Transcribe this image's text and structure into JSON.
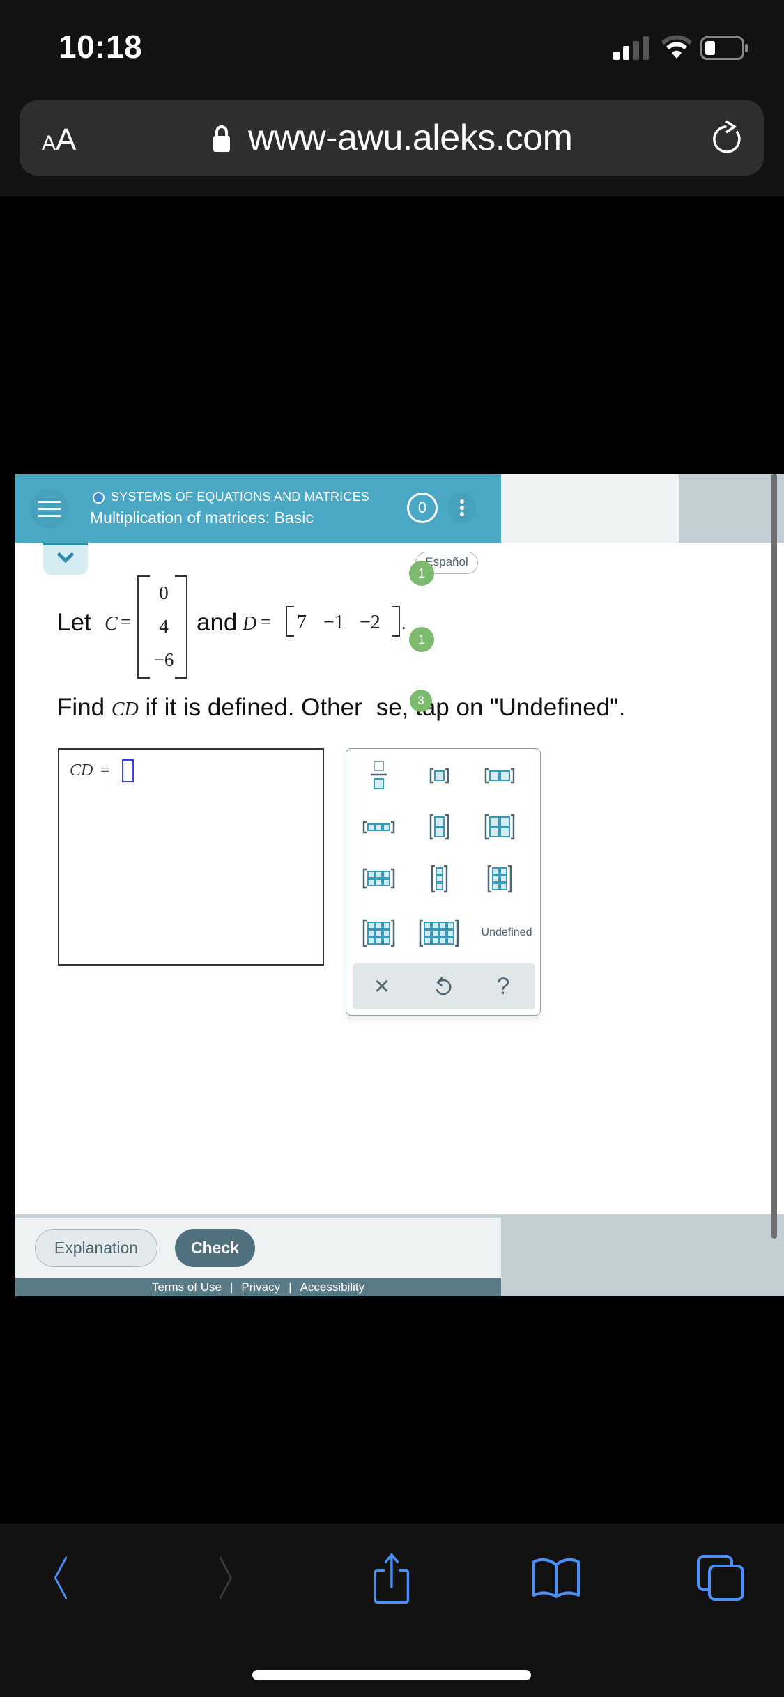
{
  "status_bar": {
    "time": "10:18",
    "icons": [
      "cellular-signal-icon",
      "wifi-icon",
      "battery-icon"
    ]
  },
  "browser": {
    "text_size_label_small": "A",
    "text_size_label_large": "A",
    "url": "www-awu.aleks.com",
    "secure": true
  },
  "header": {
    "topic": "SYSTEMS OF EQUATIONS AND MATRICES",
    "lesson": "Multiplication of matrices: Basic",
    "score": "0"
  },
  "language_button": "Español",
  "badges": [
    "1",
    "1",
    "3"
  ],
  "problem": {
    "let": "Let",
    "c_var": "C",
    "eq": "=",
    "c_values": [
      "0",
      "4",
      "−6"
    ],
    "and": "and",
    "d_var": "D",
    "d_values": [
      "7",
      "−1",
      "−2"
    ],
    "period": ".",
    "instruction": "Find CD if it is defined. Otherwise, tap on \"Undefined\".",
    "instruction_parts": {
      "pre": "Find ",
      "var": "CD",
      "post": " if it is defined. Other",
      "post2": "se, tap on \"Undefined\"."
    }
  },
  "answer": {
    "label": "CD",
    "eq": "=",
    "value": ""
  },
  "keypad": {
    "keys": [
      {
        "name": "fraction",
        "rows": 0,
        "cols": 0
      },
      {
        "name": "matrix-1x1",
        "rows": 1,
        "cols": 1
      },
      {
        "name": "matrix-1x2",
        "rows": 1,
        "cols": 2
      },
      {
        "name": "matrix-1x3",
        "rows": 1,
        "cols": 3
      },
      {
        "name": "matrix-2x1",
        "rows": 2,
        "cols": 1
      },
      {
        "name": "matrix-2x2",
        "rows": 2,
        "cols": 2
      },
      {
        "name": "matrix-2x3",
        "rows": 2,
        "cols": 3
      },
      {
        "name": "matrix-3x1",
        "rows": 3,
        "cols": 1
      },
      {
        "name": "matrix-3x2",
        "rows": 3,
        "cols": 2
      },
      {
        "name": "matrix-3x3",
        "rows": 3,
        "cols": 3
      },
      {
        "name": "matrix-3x4",
        "rows": 3,
        "cols": 4
      }
    ],
    "undefined_label": "Undefined",
    "clear": "×",
    "undo": "↺",
    "help": "?"
  },
  "footer": {
    "explanation": "Explanation",
    "check": "Check",
    "links": [
      "Terms of Use",
      "Privacy",
      "Accessibility"
    ],
    "separator": "|"
  },
  "toolbar": {
    "icons": [
      "back-icon",
      "forward-icon",
      "share-icon",
      "bookmarks-icon",
      "tabs-icon"
    ]
  },
  "colors": {
    "header": "#4aa8c4",
    "badge": "#7cbb6e",
    "check_button": "#4f707c",
    "safari_blue": "#4e8ef7",
    "input_border": "#3340ff"
  }
}
